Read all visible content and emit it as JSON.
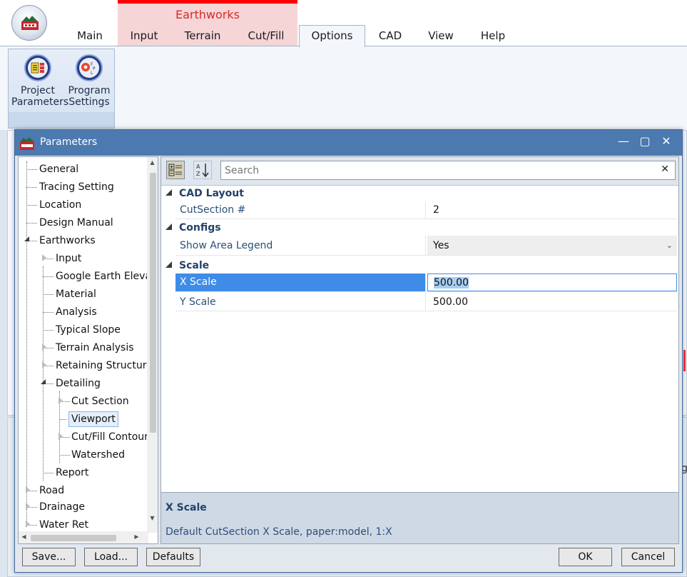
{
  "ribbon": {
    "context_group_label": "Earthworks",
    "tabs": [
      "Main",
      "Input",
      "Terrain",
      "Cut/Fill",
      "Options",
      "CAD",
      "View",
      "Help"
    ],
    "active_tab": "Options",
    "buttons": [
      {
        "line1": "Project",
        "line2": "Parameters",
        "icon": "project-parameters-icon"
      },
      {
        "line1": "Program",
        "line2": "Settings",
        "icon": "program-settings-icon"
      }
    ]
  },
  "background": {
    "peek_text": "g"
  },
  "dialog": {
    "title": "Parameters",
    "window_controls": {
      "minimize": "—",
      "maximize": "▢",
      "close": "✕"
    },
    "tree": [
      {
        "label": "General"
      },
      {
        "label": "Tracing Setting"
      },
      {
        "label": "Location"
      },
      {
        "label": "Design Manual"
      },
      {
        "label": "Earthworks",
        "expanded": true
      },
      {
        "label": "Input"
      },
      {
        "label": "Google Earth Elevat"
      },
      {
        "label": "Material"
      },
      {
        "label": "Analysis"
      },
      {
        "label": "Typical Slope"
      },
      {
        "label": "Terrain Analysis"
      },
      {
        "label": "Retaining Structure"
      },
      {
        "label": "Detailing",
        "expanded": true
      },
      {
        "label": "Cut Section"
      },
      {
        "label": "Viewport",
        "selected": true
      },
      {
        "label": "Cut/Fill Contour"
      },
      {
        "label": "Watershed"
      },
      {
        "label": "Report"
      },
      {
        "label": "Road"
      },
      {
        "label": "Drainage"
      },
      {
        "label": "Water Ret"
      }
    ],
    "property_grid": {
      "search_placeholder": "Search",
      "clear_glyph": "✕",
      "categories": [
        {
          "name": "CAD Layout",
          "rows": [
            {
              "name": "CutSection #",
              "value": "2"
            }
          ]
        },
        {
          "name": "Configs",
          "rows": [
            {
              "name": "Show Area Legend",
              "value": "Yes",
              "dropdown": true
            }
          ]
        },
        {
          "name": "Scale",
          "rows": [
            {
              "name": "X Scale",
              "value": "500.00",
              "selected": true
            },
            {
              "name": "Y Scale",
              "value": "500.00"
            }
          ]
        }
      ],
      "description": {
        "title": "X Scale",
        "text": "Default CutSection X Scale, paper:model, 1:X"
      }
    },
    "buttons": {
      "save": "Save...",
      "load": "Load...",
      "defaults": "Defaults",
      "ok": "OK",
      "cancel": "Cancel"
    }
  }
}
